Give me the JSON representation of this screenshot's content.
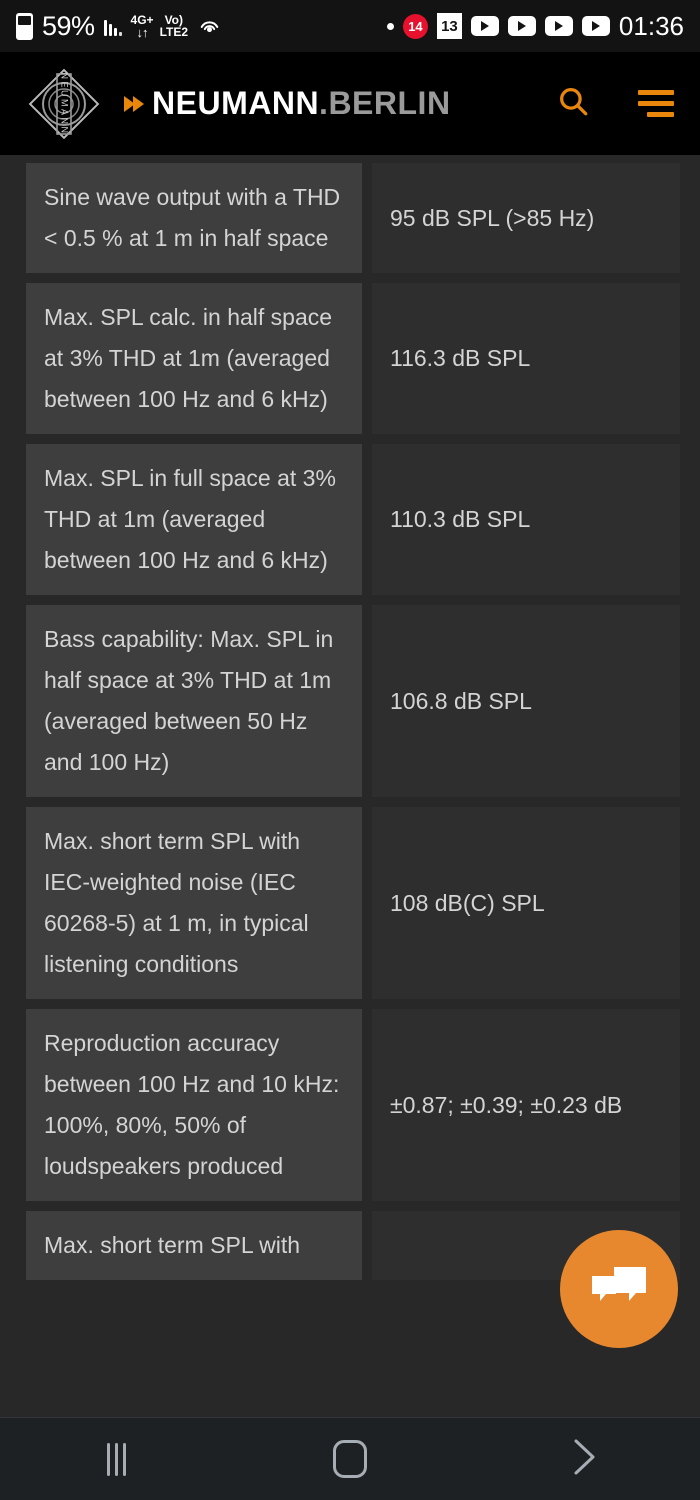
{
  "status_bar": {
    "battery_percent": "59%",
    "battery_icon": "battery-icon",
    "signal_icon": "signal-bars-icon",
    "network_type_top": "4G+",
    "network_type_bottom": "LTE2",
    "data_arrows": "↓↑",
    "volte_label": "Vo)",
    "volte_top": "Vo)",
    "hotspot_icon": "hotspot-icon",
    "dot_icon": "dot-indicator-icon",
    "notification_count": "14",
    "app_badge": "13",
    "youtube_icons": [
      "youtube-icon",
      "youtube-icon",
      "youtube-icon",
      "youtube-icon"
    ],
    "clock": "01:36"
  },
  "site_header": {
    "logo_name": "neumann-diamond-logo",
    "logo_inner_text": "NEUMANN",
    "wordmark_primary": "NEUMANN",
    "wordmark_secondary": ".BERLIN",
    "chevron_icon": "double-chevron-right-icon",
    "search_icon": "search-icon",
    "menu_icon": "hamburger-menu-icon",
    "accent_color": "#e8870b",
    "background_color": "#000000"
  },
  "spec_table": {
    "label_cell_bg": "#3e3e3e",
    "value_cell_bg": "#2e2e2e",
    "text_color": "#d4d4d4",
    "rows": [
      {
        "label": "Sine wave output with a THD < 0.5 % at 1 m in half space",
        "value": "95 dB SPL (>85 Hz)"
      },
      {
        "label": "Max. SPL calc. in half space at 3% THD at 1m (averaged between 100 Hz and 6 kHz)",
        "value": "116.3 dB SPL"
      },
      {
        "label": "Max. SPL in full space at 3% THD at 1m (averaged between 100 Hz and 6 kHz)",
        "value": "110.3 dB SPL"
      },
      {
        "label": "Bass capability: Max. SPL in half space at 3% THD at 1m (averaged between 50 Hz and 100 Hz)",
        "value": "106.8 dB SPL"
      },
      {
        "label": "Max. short term SPL with IEC-weighted noise (IEC 60268-5) at 1 m, in typical listening conditions",
        "value": "108 dB(C) SPL"
      },
      {
        "label": "Reproduction accuracy between 100 Hz and 10 kHz: 100%, 80%, 50% of loudspeakers produced",
        "value": "±0.87; ±0.39; ±0.23 dB"
      },
      {
        "label": "Max. short term SPL with",
        "value": ""
      }
    ]
  },
  "chat_fab": {
    "icon": "chat-bubbles-icon",
    "color": "#e8882e"
  },
  "nav_bar": {
    "recents_icon": "recents-icon",
    "home_icon": "home-icon",
    "back_icon": "back-chevron-icon",
    "background_color": "#1e2124"
  }
}
